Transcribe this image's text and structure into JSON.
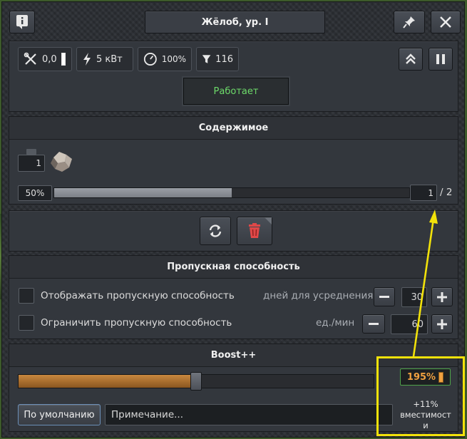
{
  "window": {
    "title": "Жёлоб, ур. I"
  },
  "status": {
    "repair": "0,0",
    "power": "5 кВт",
    "efficiency": "100%",
    "filter": "116",
    "state_label": "Работает",
    "state_color": "#6ddb6a"
  },
  "contents": {
    "title": "Содержимое",
    "item_count": "1",
    "fill_label": "50%",
    "fill_fraction": 0.5,
    "slot_value": "1",
    "slot_max": "/ 2"
  },
  "throughput": {
    "title": "Пропускная способность",
    "show_label": "Отображать пропускную способность",
    "days_label": "дней для усреднения",
    "days_value": "30",
    "limit_label": "Ограничить пропускную способность",
    "units_label": "ед./мин",
    "units_value": "60"
  },
  "boost": {
    "title": "Boost++",
    "fill_fraction": 0.5,
    "percent_label": "195%",
    "bonus_label": "+11%\nвместимост\nи",
    "default_button": "По умолчанию",
    "note_placeholder": "Примечание...",
    "accent": "#f0a040"
  },
  "annotation": {
    "color": "#f2e20a"
  }
}
